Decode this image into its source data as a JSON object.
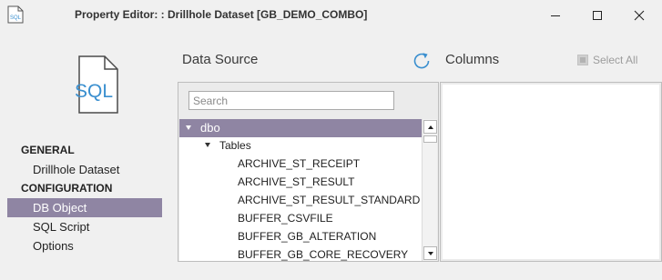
{
  "window": {
    "title": "Property Editor: : Drillhole Dataset [GB_DEMO_COMBO]",
    "app_icon": "sql-file-icon",
    "app_icon_text": "SQL",
    "buttons": [
      "minimize-icon",
      "maximize-icon",
      "close-icon"
    ]
  },
  "hero_icon": {
    "name": "sql-file-icon",
    "text": "SQL",
    "color": "#3a8fcf"
  },
  "nav": {
    "general_header": "GENERAL",
    "general_items": [
      {
        "label": "Drillhole Dataset",
        "selected": false
      }
    ],
    "configuration_header": "CONFIGURATION",
    "configuration_items": [
      {
        "label": "DB Object",
        "selected": true
      },
      {
        "label": "SQL Script",
        "selected": false
      },
      {
        "label": "Options",
        "selected": false
      }
    ]
  },
  "data_source": {
    "heading": "Data Source",
    "search": {
      "placeholder": "Search",
      "value": ""
    },
    "refresh_icon": "refresh-icon",
    "tree": [
      {
        "label": "dbo",
        "level": 0,
        "expanded": true,
        "selected": true
      },
      {
        "label": "Tables",
        "level": 1,
        "expanded": true,
        "selected": false
      },
      {
        "label": "ARCHIVE_ST_RECEIPT",
        "level": 2
      },
      {
        "label": "ARCHIVE_ST_RESULT",
        "level": 2
      },
      {
        "label": "ARCHIVE_ST_RESULT_STANDARD",
        "level": 2
      },
      {
        "label": "BUFFER_CSVFILE",
        "level": 2
      },
      {
        "label": "BUFFER_GB_ALTERATION",
        "level": 2
      },
      {
        "label": "BUFFER_GB_CORE_RECOVERY",
        "level": 2
      }
    ]
  },
  "columns": {
    "heading": "Columns",
    "select_all_label": "Select All",
    "select_all_enabled": false
  },
  "colors": {
    "selection": "#8f85a3",
    "accent": "#3a8fcf",
    "background": "#f0f0f0"
  }
}
